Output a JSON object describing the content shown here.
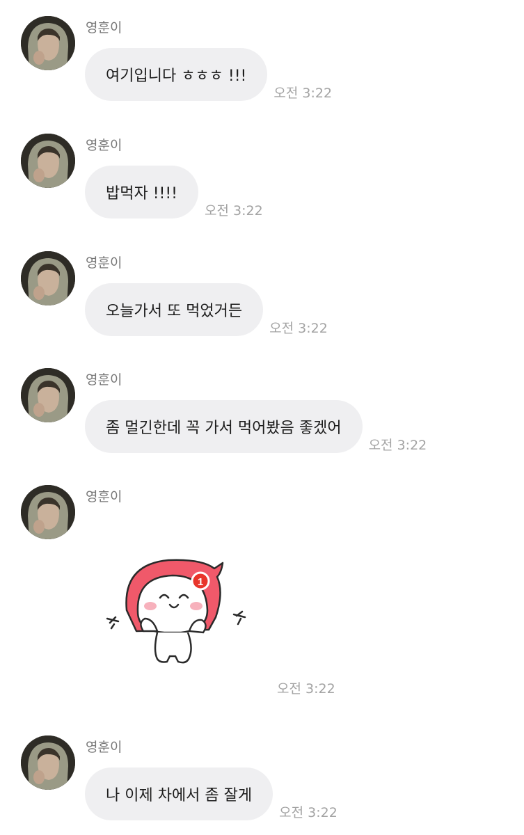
{
  "messages": [
    {
      "sender": "영훈이",
      "text": "여기입니다 ㅎㅎㅎ !!!",
      "time": "오전 3:22"
    },
    {
      "sender": "영훈이",
      "text": "밥먹자 !!!!",
      "time": "오전 3:22"
    },
    {
      "sender": "영훈이",
      "text": "오늘가서 또 먹었거든",
      "time": "오전 3:22"
    },
    {
      "sender": "영훈이",
      "text": "좀 멀긴한데 꼭 가서 먹어봤음 좋겠어",
      "time": "오전 3:22"
    },
    {
      "sender": "영훈이",
      "sticker": {
        "badge": "1"
      },
      "time": "오전 3:22"
    },
    {
      "sender": "영훈이",
      "text": "나 이제 차에서 좀 잘게",
      "time": "오전 3:22"
    }
  ],
  "colors": {
    "bubble": "#efeff1",
    "sticker_hood": "#f0596a",
    "sticker_badge": "#e8352b"
  }
}
